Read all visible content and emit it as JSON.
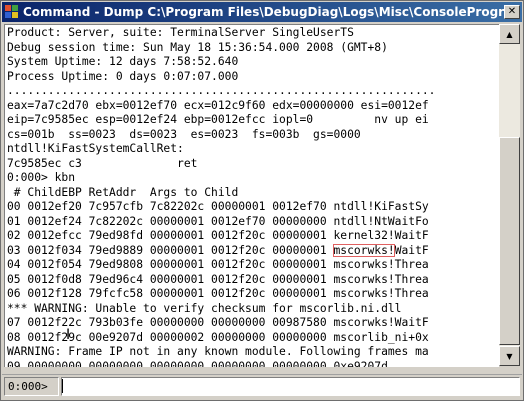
{
  "window": {
    "title": "Command - Dump C:\\Program Files\\DebugDiag\\Logs\\Misc\\ConsoleProgram",
    "close_glyph": "✕"
  },
  "output": {
    "lines": [
      "Product: Server, suite: TerminalServer SingleUserTS",
      "Debug session time: Sun May 18 15:36:54.000 2008 (GMT+8)",
      "System Uptime: 12 days 7:58:52.640",
      "Process Uptime: 0 days 0:07:07.000",
      "...............................................................",
      "eax=7a7c2d70 ebx=0012ef70 ecx=012c9f60 edx=00000000 esi=0012ef",
      "eip=7c9585ec esp=0012ef24 ebp=0012efcc iopl=0         nv up ei",
      "cs=001b  ss=0023  ds=0023  es=0023  fs=003b  gs=0000",
      "ntdll!KiFastSystemCallRet:",
      "7c9585ec c3              ret",
      "0:000> kbn",
      " # ChildEBP RetAddr  Args to Child",
      "00 0012ef20 7c957cfb 7c82202c 00000001 0012ef70 ntdll!KiFastSy",
      "01 0012ef24 7c82202c 00000001 0012ef70 00000000 ntdll!NtWaitFo",
      "02 0012efcc 79ed98fd 00000001 0012f20c 00000001 kernel32!WaitF",
      "03 0012f034 79ed9889 00000001 0012f20c 00000001 mscorwks!WaitF",
      "04 0012f054 79ed9808 00000001 0012f20c 00000001 mscorwks!Threa",
      "05 0012f0d8 79ed96c4 00000001 0012f20c 00000001 mscorwks!Threa",
      "06 0012f128 79fcfc58 00000001 0012f20c 00000001 mscorwks!Threa",
      "*** WARNING: Unable to verify checksum for mscorlib.ni.dll",
      "07 0012f22c 793b03fe 00000000 00000000 00987580 mscorwks!WaitF",
      "08 0012f29c 00e9207d 00000002 00000000 00000000 mscorlib_ni+0x",
      "WARNING: Frame IP not in any known module. Following frames ma",
      "09 00000000 00000000 00000000 00000000 00000000 0xe9207d"
    ],
    "highlight_text": "mscorwks!",
    "highlight_row": 15
  },
  "command_bar": {
    "prompt": "0:000>",
    "input_value": ""
  },
  "scrollbar": {
    "up_glyph": "▲",
    "down_glyph": "▼"
  }
}
